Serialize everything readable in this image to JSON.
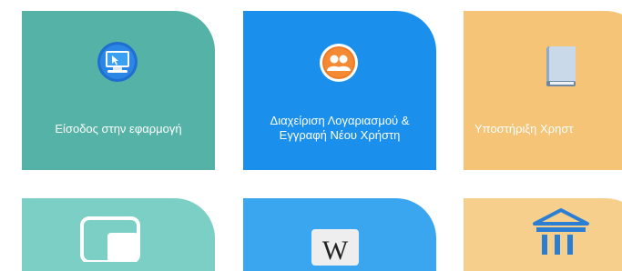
{
  "tiles": [
    {
      "label": "Είσοδος στην εφαρμογή",
      "icon": "computer-login-icon",
      "color": "#54b3a6"
    },
    {
      "label_line1": "Διαχείριση Λογαριασμού &",
      "label_line2": "Εγγραφή Νέου Χρήστη",
      "icon": "user-account-icon",
      "color": "#1a90ec"
    },
    {
      "label": "Υποστήριξη Χρηστ",
      "icon": "book-icon",
      "color": "#f5c476"
    },
    {
      "icon": "window-icon",
      "color": "#7ccfc5"
    },
    {
      "icon": "wikipedia-icon",
      "text": "W",
      "color": "#3aa6f0"
    },
    {
      "icon": "institution-icon",
      "color": "#f7cf8c"
    }
  ]
}
